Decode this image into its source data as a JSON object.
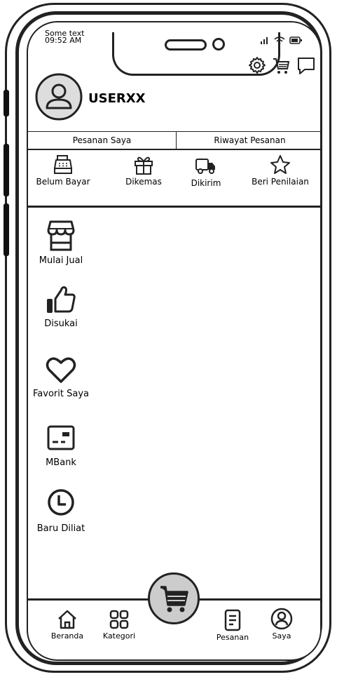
{
  "status_bar": {
    "carrier": "Some text",
    "time": "09:52 AM"
  },
  "profile": {
    "username": "USERXX"
  },
  "order_tabs": [
    {
      "label": "Pesanan Saya"
    },
    {
      "label": "Riwayat Pesanan"
    }
  ],
  "order_status": [
    {
      "label": "Belum Bayar",
      "icon": "cash-register-icon"
    },
    {
      "label": "Dikemas",
      "icon": "gift-icon"
    },
    {
      "label": "Dikirim",
      "icon": "truck-icon"
    },
    {
      "label": "Beri Penilaian",
      "icon": "star-icon"
    }
  ],
  "menu": [
    {
      "label": "Mulai Jual",
      "icon": "store-icon"
    },
    {
      "label": "Disukai",
      "icon": "thumbs-up-icon"
    },
    {
      "label": "Favorit Saya",
      "icon": "heart-icon"
    },
    {
      "label": "MBank",
      "icon": "card-icon"
    },
    {
      "label": "Baru Diliat",
      "icon": "clock-icon"
    }
  ],
  "bottom_nav": [
    {
      "label": "Beranda",
      "icon": "home-icon"
    },
    {
      "label": "Kategori",
      "icon": "grid-icon"
    },
    {
      "label": "",
      "icon": "cart-icon"
    },
    {
      "label": "Pesanan",
      "icon": "document-icon"
    },
    {
      "label": "Saya",
      "icon": "user-icon"
    }
  ]
}
